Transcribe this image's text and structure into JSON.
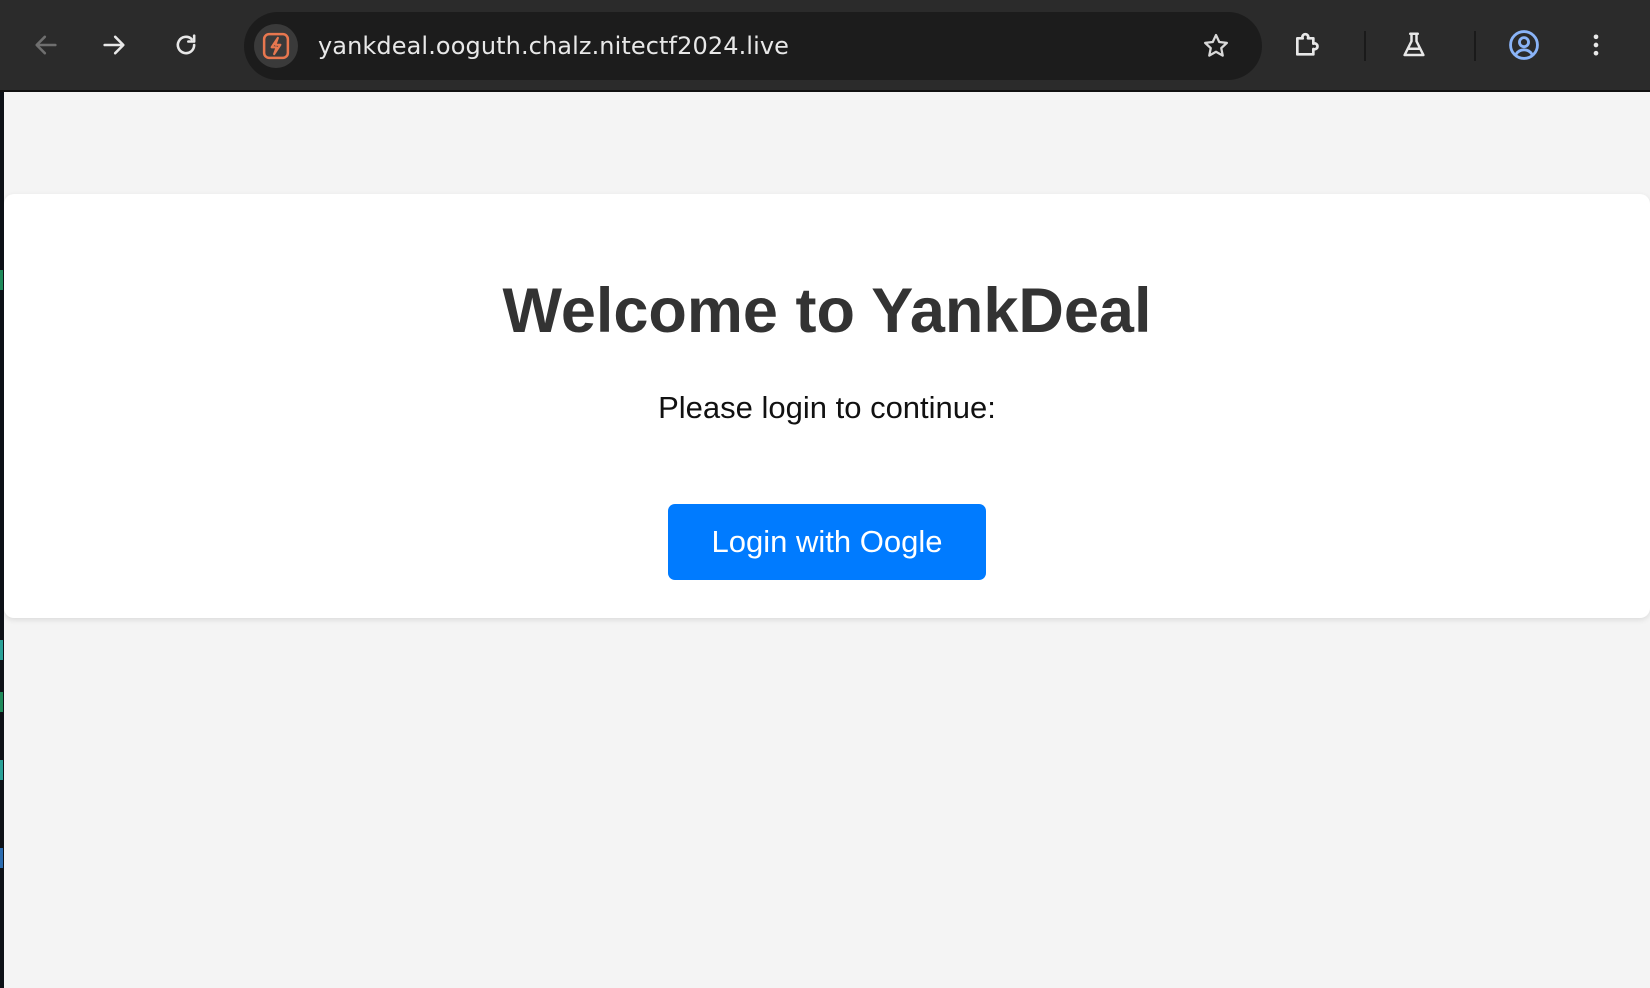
{
  "browser": {
    "url": "yankdeal.ooguth.chalz.nitectf2024.live",
    "icons": {
      "back": "arrow-left-icon",
      "forward": "arrow-right-icon",
      "reload": "reload-icon",
      "site_info": "site-lightning-icon",
      "bookmark": "star-icon",
      "extensions": "puzzle-piece-icon",
      "labs": "flask-icon",
      "profile": "account-circle-icon",
      "menu": "kebab-menu-icon"
    },
    "colors": {
      "toolbar": "#2b2b2b",
      "omnibox": "#1c1c1c",
      "site_icon": "#e8774f",
      "profile_icon": "#8ab4f8"
    }
  },
  "page": {
    "title": "Welcome to YankDeal",
    "subtitle": "Please login to continue:",
    "login_button_label": "Login with Oogle",
    "colors": {
      "background": "#f4f4f4",
      "card": "#ffffff",
      "heading": "#333333",
      "button": "#007bff",
      "button_text": "#ffffff"
    }
  }
}
